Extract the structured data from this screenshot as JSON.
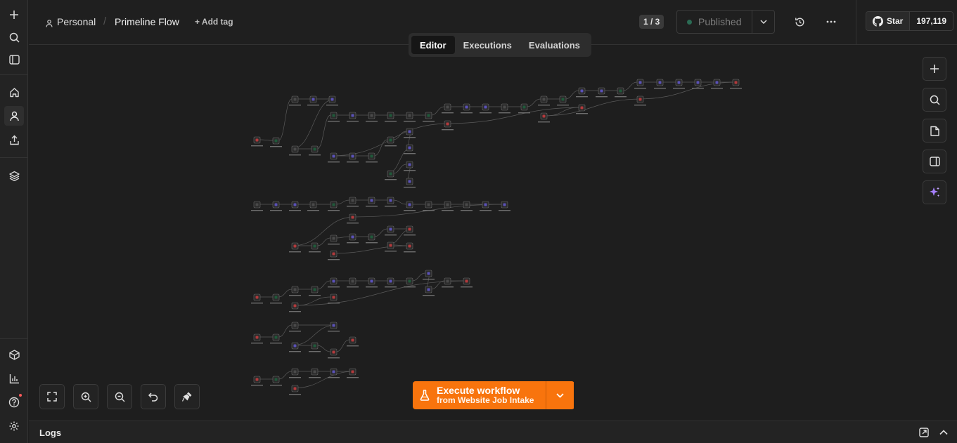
{
  "rail": {
    "top_items": [
      "add-icon",
      "search-icon",
      "sidebar-toggle-icon"
    ],
    "nav_items": [
      "home-icon",
      "user-icon",
      "share-icon"
    ],
    "mid_items": [
      "layers-icon"
    ],
    "bottom_items": [
      "templates-icon",
      "insights-icon",
      "help-icon",
      "settings-icon"
    ]
  },
  "header": {
    "project": "Personal",
    "separator": "/",
    "workflow_name": "Primeline Flow",
    "add_tag": "+ Add tag",
    "version_counter": "1 / 3",
    "publish_status": "Published",
    "github_star_label": "Star",
    "github_star_count": "197,119"
  },
  "tabs": [
    {
      "label": "Editor",
      "active": true
    },
    {
      "label": "Executions",
      "active": false
    },
    {
      "label": "Evaluations",
      "active": false
    }
  ],
  "execute": {
    "title": "Execute workflow",
    "subtitle": "from Website Job Intake"
  },
  "logs": {
    "label": "Logs"
  },
  "colors": {
    "accent": "#f8740d",
    "node_green": "#1f5a3a",
    "node_purple": "#6a5fd0",
    "node_red": "#c0393b",
    "node_gray": "#4a4a4a",
    "ai_purple": "#a780ff"
  }
}
